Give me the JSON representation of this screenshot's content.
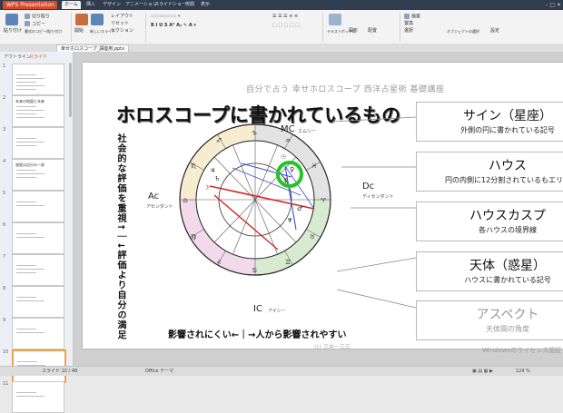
{
  "app": {
    "name": "WPS Presentation",
    "menu_tabs": [
      "ホーム",
      "挿入",
      "デザイン",
      "アニメーション",
      "スライドショー",
      "校閲",
      "表示"
    ],
    "active_tab": "ホーム"
  },
  "ribbon": {
    "items": [
      "貼り付け",
      "切り取り",
      "コピー",
      "書式のコピー/貼り付け",
      "開始",
      "新しいスライド",
      "レイアウト",
      "リセット",
      "セクション",
      "テキストボックス",
      "図形",
      "配置",
      "検索",
      "置換",
      "選択",
      "オブジェクトの選択",
      "設定"
    ]
  },
  "document_tab": "幸せホロスコープ_講座用.pptx",
  "panel": {
    "tabs": [
      "アウトライン",
      "スライド"
    ],
    "active": "スライド",
    "thumbnails": [
      {
        "num": "1",
        "title": "",
        "lines": 5
      },
      {
        "num": "2",
        "title": "未来の地図と未来",
        "lines": 4
      },
      {
        "num": "3",
        "title": "",
        "lines": 3
      },
      {
        "num": "4",
        "title": "惑星は自分の一部",
        "lines": 3
      },
      {
        "num": "5",
        "title": "",
        "lines": 2
      },
      {
        "num": "6",
        "title": "",
        "lines": 2
      },
      {
        "num": "7",
        "title": "",
        "lines": 3
      },
      {
        "num": "8",
        "title": "",
        "lines": 2
      },
      {
        "num": "9",
        "title": "",
        "lines": 2
      },
      {
        "num": "10",
        "title": "",
        "lines": 2
      },
      {
        "num": "11",
        "title": "",
        "lines": 2
      }
    ]
  },
  "slide": {
    "subtitle": "自分で占う 幸せホロスコープ 西洋占星術 基礎講座",
    "title": "ホロスコープに書かれているもの",
    "vertical_text": "社会的な評価を重視↑｜↓評価より自分の満足",
    "bottom_caption": "影響されにくい←｜→人から影響されやすい",
    "copyright": "(c) 三井一三三",
    "watermark": "Windowsのライセンス認証",
    "chart_labels": {
      "mc": "MC",
      "mc_sub": "エムシー",
      "ic": "IC",
      "ic_sub": "アイシー",
      "ac": "Ac",
      "ac_sub": "アセンダント",
      "dc": "Dc",
      "dc_sub": "ディセンダント"
    },
    "boxes": [
      {
        "title": "サイン（星座）",
        "desc": "外側の円に書かれている記号"
      },
      {
        "title": "ハウス",
        "desc": "円の内側に12分割されているもエリア"
      },
      {
        "title": "ハウスカスプ",
        "desc": "各ハウスの境界線"
      },
      {
        "title": "天体（惑星）",
        "desc": "ハウスに書かれている記号"
      },
      {
        "title": "アスペクト",
        "desc": "天体間の角度"
      }
    ]
  },
  "status": {
    "slide_info": "スライド 10 / 48",
    "theme": "Office テーマ",
    "zoom": "124 %"
  },
  "colors": {
    "accent_orange": "#d94a2b",
    "highlight_green": "#22c422",
    "aspect_red": "#d42a2a",
    "aspect_blue": "#3a4fd0"
  }
}
